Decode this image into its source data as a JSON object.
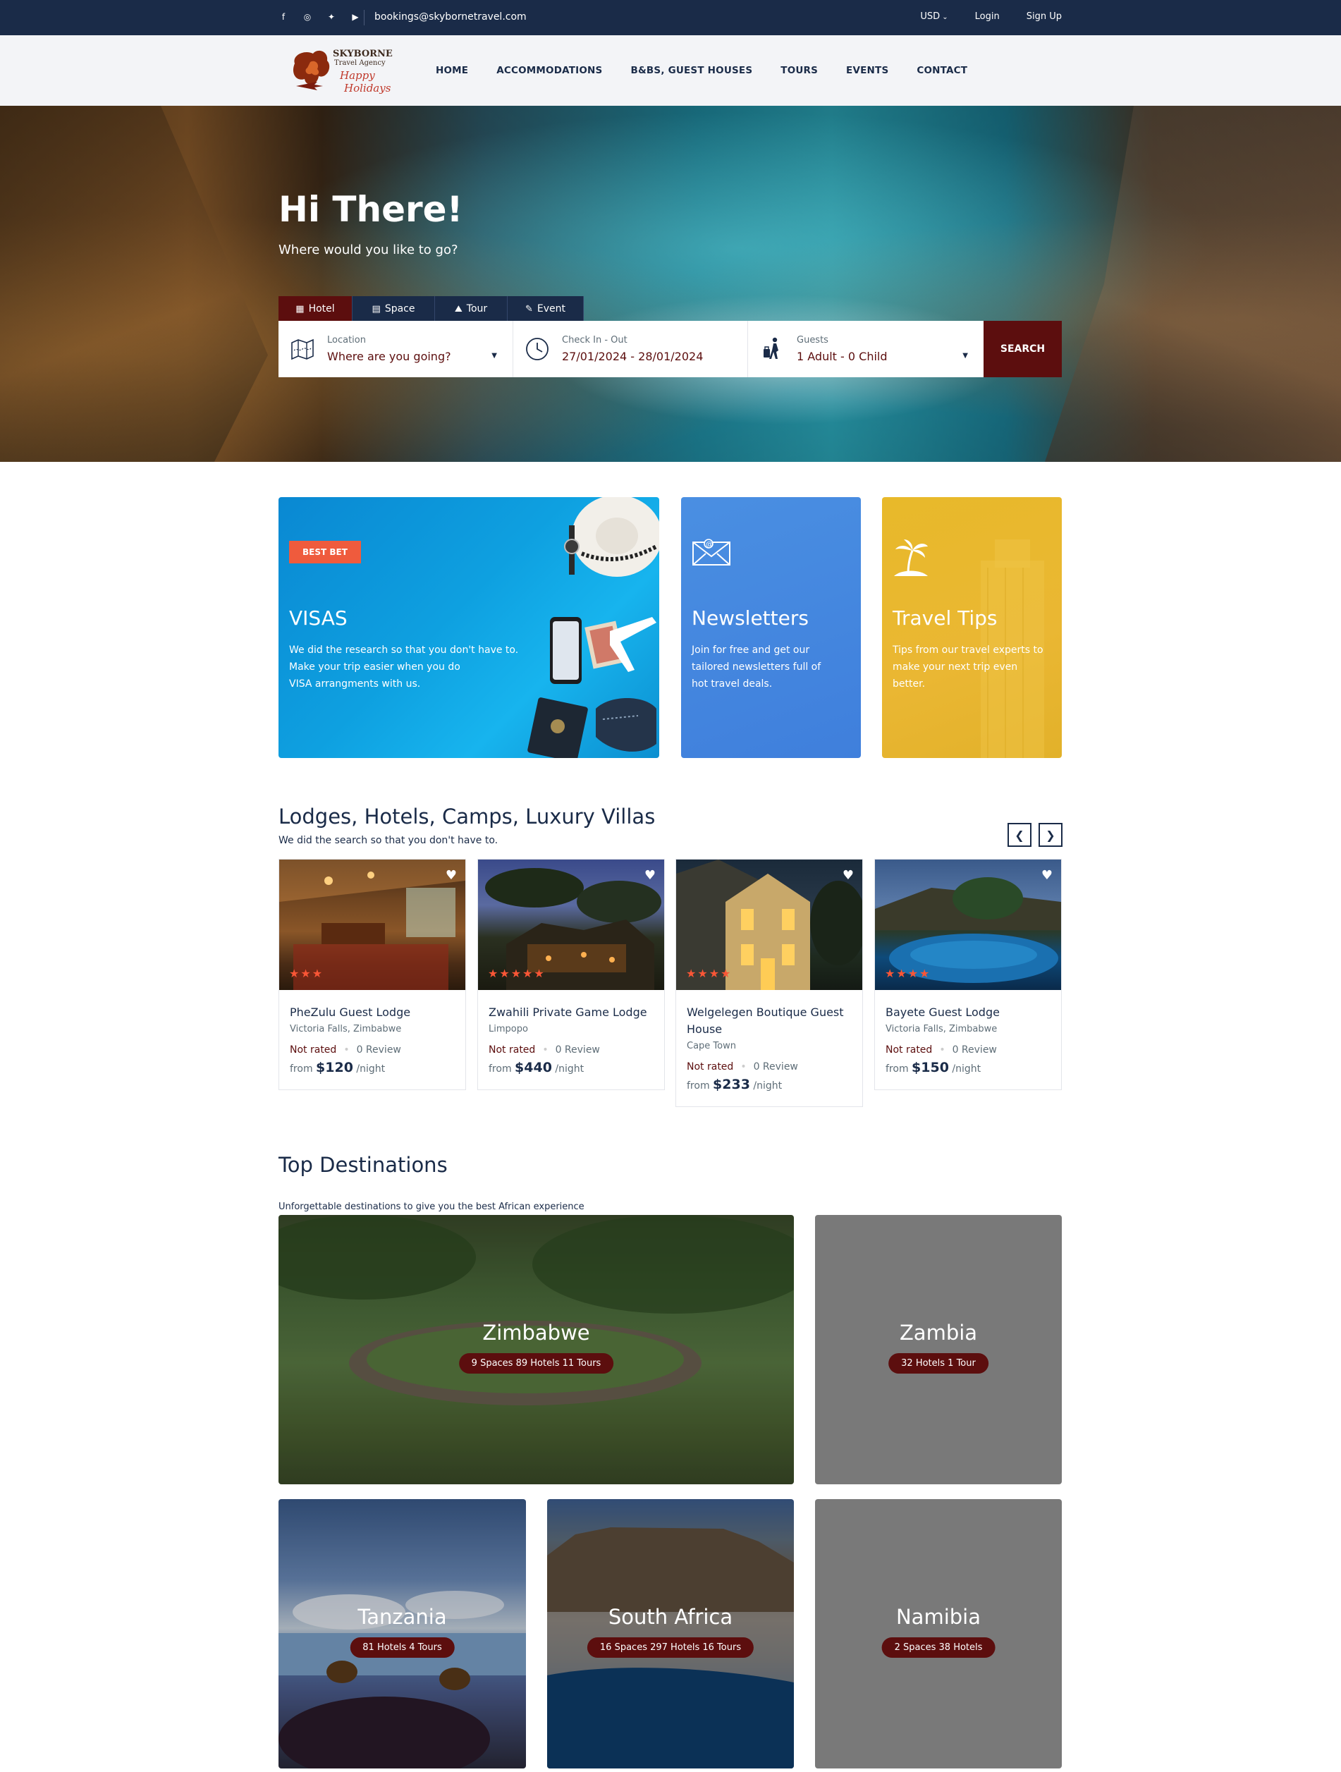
{
  "topbar": {
    "social": [
      "facebook-icon",
      "instagram-icon",
      "twitter-icon",
      "youtube-icon"
    ],
    "email": "bookings@skybornetravel.com",
    "currency": "USD",
    "login": "Login",
    "signup": "Sign Up"
  },
  "header": {
    "logo": {
      "line1": "SKYBORNE",
      "line2": "Travel Agency",
      "script1": "Happy",
      "script2": "Holidays"
    },
    "nav": [
      "HOME",
      "ACCOMMODATIONS",
      "B&BS, GUEST HOUSES",
      "TOURS",
      "EVENTS",
      "CONTACT"
    ]
  },
  "hero": {
    "title": "Hi There!",
    "subtitle": "Where would you like to go?",
    "tabs": [
      {
        "label": "Hotel",
        "icon": "building-icon"
      },
      {
        "label": "Space",
        "icon": "apartment-icon"
      },
      {
        "label": "Tour",
        "icon": "hiker-icon"
      },
      {
        "label": "Event",
        "icon": "ticket-icon"
      }
    ],
    "search": {
      "location_label": "Location",
      "location_value": "Where are you going?",
      "dates_label": "Check In - Out",
      "dates_value": "27/01/2024 - 28/01/2024",
      "guests_label": "Guests",
      "guests_value": "1 Adult - 0 Child",
      "button": "SEARCH"
    }
  },
  "promos": {
    "visas": {
      "badge": "BEST BET",
      "title": "VISAS",
      "text1": "We did the research so that you don't have to.",
      "text2": "Make your trip easier when you do",
      "text3": "VISA arrangments with us."
    },
    "newsletters": {
      "title": "Newsletters",
      "text1": "Join for free and get our",
      "text2": "tailored newsletters full of",
      "text3": "hot travel deals."
    },
    "tips": {
      "title": "Travel Tips",
      "text1": "Tips from our travel experts to",
      "text2": "make your next trip even",
      "text3": "better."
    }
  },
  "lodges": {
    "title": "Lodges, Hotels, Camps, Luxury Villas",
    "subtitle": "We did the search so that you don't have to.",
    "prev": "❮",
    "next": "❯",
    "cards": [
      {
        "name": "PheZulu Guest Lodge",
        "location": "Victoria Falls, Zimbabwe",
        "rating": "Not rated",
        "reviews": "0 Review",
        "from": "from",
        "price": "$120",
        "unit": "/night",
        "stars": "★★★"
      },
      {
        "name": "Zwahili Private Game Lodge",
        "location": "Limpopo",
        "rating": "Not rated",
        "reviews": "0 Review",
        "from": "from",
        "price": "$440",
        "unit": "/night",
        "stars": "★★★★★"
      },
      {
        "name": "Welgelegen Boutique Guest House",
        "location": "Cape Town",
        "rating": "Not rated",
        "reviews": "0 Review",
        "from": "from",
        "price": "$233",
        "unit": "/night",
        "stars": "★★★★"
      },
      {
        "name": "Bayete Guest Lodge",
        "location": "Victoria Falls, Zimbabwe",
        "rating": "Not rated",
        "reviews": "0 Review",
        "from": "from",
        "price": "$150",
        "unit": "/night",
        "stars": "★★★★"
      }
    ]
  },
  "destinations": {
    "title": "Top Destinations",
    "subtitle": "Unforgettable destinations to give you the best African experience",
    "items": [
      {
        "name": "Zimbabwe",
        "stats": "9 Spaces 89 Hotels 11 Tours"
      },
      {
        "name": "Zambia",
        "stats": "32 Hotels 1 Tour"
      },
      {
        "name": "Tanzania",
        "stats": "81 Hotels 4 Tours"
      },
      {
        "name": "South Africa",
        "stats": "16 Spaces 297 Hotels 16 Tours"
      },
      {
        "name": "Namibia",
        "stats": "2 Spaces 38 Hotels"
      }
    ]
  },
  "colors": {
    "navy": "#1a2b48",
    "maroon": "#5c0e0e",
    "coral": "#ef5b3d",
    "star": "#fa5636"
  }
}
